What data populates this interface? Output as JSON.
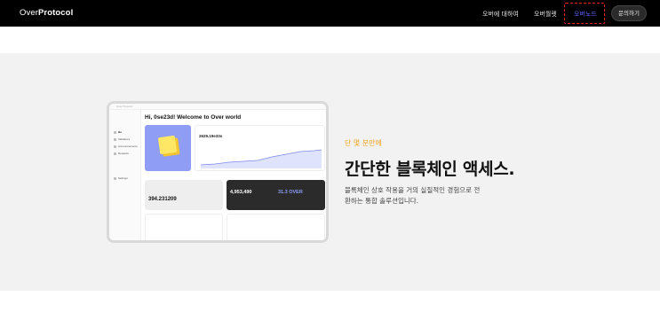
{
  "header": {
    "logo_light": "Over",
    "logo_bold": "Protocol",
    "nav": [
      "오버에 대하여",
      "오버월렛",
      "오버노드"
    ],
    "contact_label": "문의하기",
    "colors": {
      "bar": "#000000",
      "highlight": "#5b64ff",
      "focus_outline": "#ff2020"
    }
  },
  "hero": {
    "tagline": "단 몇 분만에",
    "headline": "간단한 블록체인 액세스.",
    "description_line1": "블록체인 상호 작용을 거의 실질적인 경험으로 전",
    "description_line2": "환하는 통합 솔루션입니다.",
    "tagline_color": "#f0a020"
  },
  "mockup": {
    "window_title": "Over Protocol",
    "greeting": "Hi, 0se23d! Welcome to Over world",
    "sidebar": [
      "Ho",
      "Validators",
      "Announcements",
      "Rewards",
      "Settings"
    ],
    "chart_value": "2629.19e33s",
    "total_balance": "394.231209",
    "validators_value": "4,953,490",
    "rewards_value": "31.3 OVER"
  }
}
